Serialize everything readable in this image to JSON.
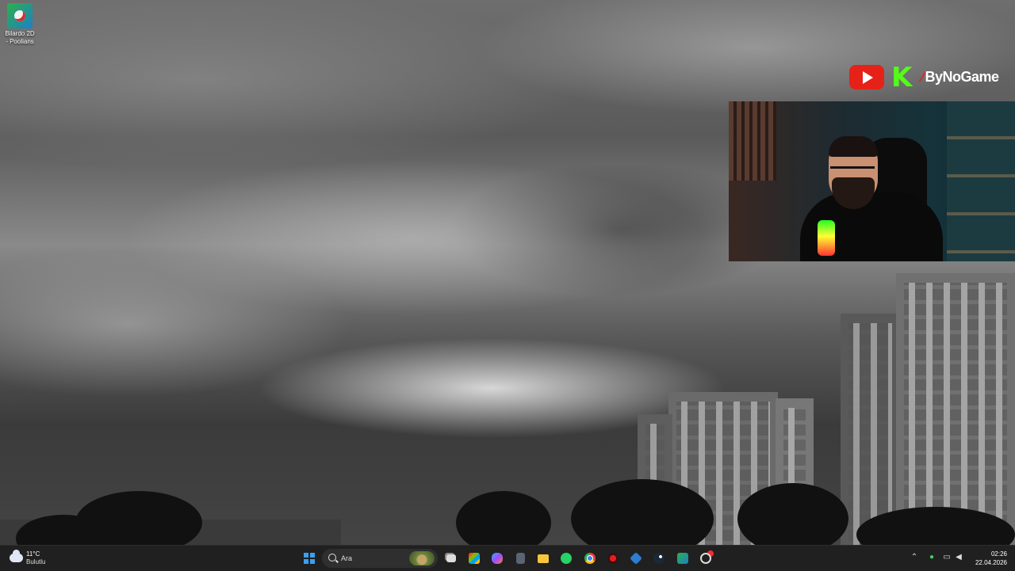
{
  "desktop": {
    "icons": [
      {
        "label": "Bilardo 2D - Poolians",
        "icon": "billiards-game-icon"
      }
    ]
  },
  "overlay": {
    "brand": "ByNoGame",
    "youtube_color": "#e62117",
    "kick_glyph": "K",
    "kick_color": "#53fc18"
  },
  "taskbar": {
    "weather": {
      "temp": "11°C",
      "condition": "Bulutlu",
      "icon": "cloud-icon"
    },
    "search": {
      "placeholder": "Ara"
    },
    "pinned": [
      "windows-start-icon",
      "task-view-icon",
      "microsoft-store-icon",
      "copilot-icon",
      "calculator-icon",
      "file-explorer-icon",
      "whatsapp-icon",
      "chrome-icon",
      "record-icon",
      "app-icon",
      "steam-icon",
      "billiards-game-icon",
      "paint-icon"
    ],
    "tray": {
      "icons": [
        "chevron-up-icon",
        "microphone-icon",
        "display-icon",
        "speaker-icon"
      ]
    },
    "clock": {
      "time": "02:26",
      "date": "22.04.2026"
    }
  }
}
